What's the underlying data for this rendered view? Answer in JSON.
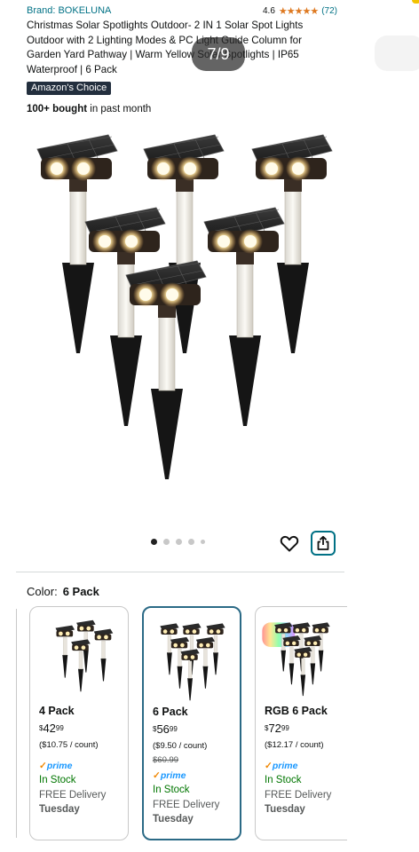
{
  "header": {
    "brand": "Brand: BOKELUNA",
    "rating_value": "4.6",
    "rating_stars": "★★★★★",
    "rating_count": "(72)",
    "title": "Christmas Solar Spotlights Outdoor- 2 IN 1 Solar Spot Lights Outdoor with 2 Lighting Modes & PC Light Guide Column for Garden Yard Pathway | Warm Yellow Solar Spotlights | IP65 Waterproof | 6 Pack",
    "badge": "Amazon's Choice",
    "bought_strong": "100+ bought",
    "bought_rest": "in past month"
  },
  "gallery": {
    "counter": "7/9",
    "dots_total": 5,
    "active_index": 0
  },
  "color": {
    "label": "Color:",
    "selected": "6 Pack"
  },
  "variants": [
    {
      "name": "4 Pack",
      "currency": "$",
      "dollars": "42",
      "cents": "99",
      "unit_price": "($10.75 / count)",
      "list_price": "",
      "prime": "prime",
      "stock": "In Stock",
      "delivery": "FREE Delivery",
      "day": "Tuesday"
    },
    {
      "name": "6 Pack",
      "currency": "$",
      "dollars": "56",
      "cents": "99",
      "unit_price": "($9.50 / count)",
      "list_price": "$60.99",
      "prime": "prime",
      "stock": "In Stock",
      "delivery": "FREE Delivery",
      "day": "Tuesday"
    },
    {
      "name": "RGB 6 Pack",
      "currency": "$",
      "dollars": "72",
      "cents": "99",
      "unit_price": "($12.17 / count)",
      "list_price": "",
      "prime": "prime",
      "stock": "In Stock",
      "delivery": "FREE Delivery",
      "day": "Tuesday"
    }
  ],
  "colors": {
    "link": "#007185",
    "star": "#de7921",
    "stock": "#007600",
    "prime": "#1a98ff",
    "badge_bg": "#232f3e",
    "selected_border": "#2b6a86"
  },
  "icons": {
    "favorite": "heart-icon",
    "share": "share-icon",
    "prime_check": "check-icon"
  }
}
